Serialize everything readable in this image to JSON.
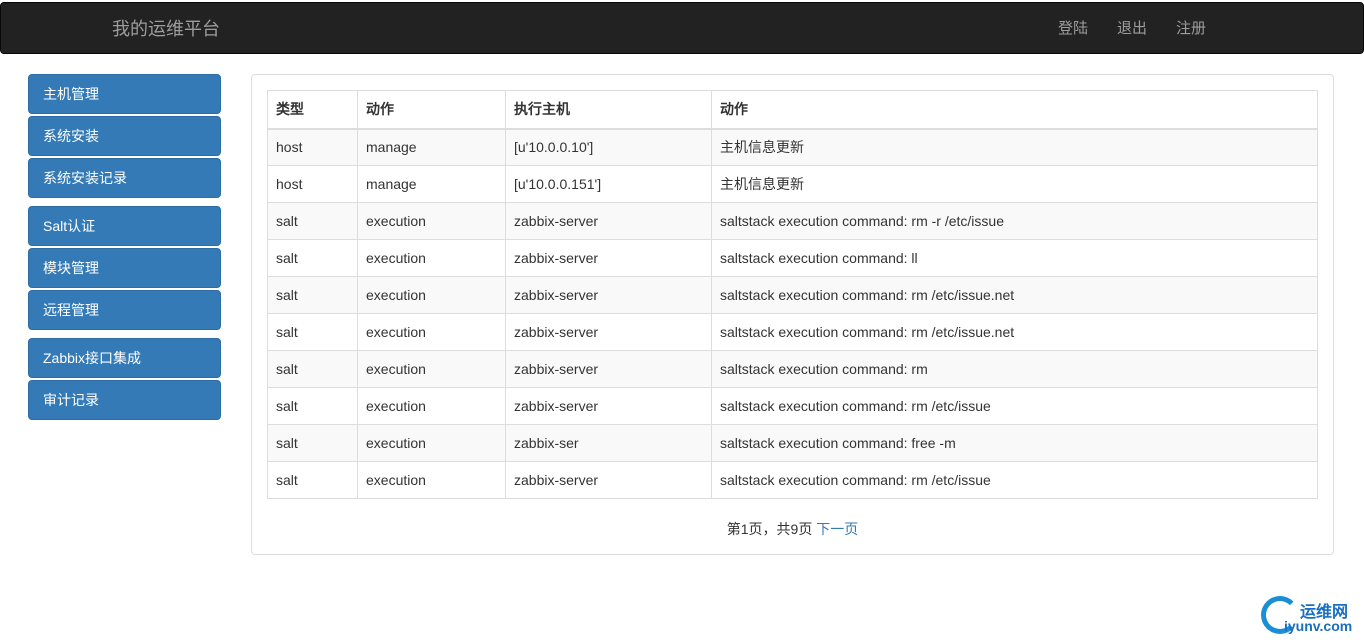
{
  "navbar": {
    "brand": "我的运维平台",
    "links": [
      "登陆",
      "退出",
      "注册"
    ]
  },
  "sidebar": {
    "items": [
      "主机管理",
      "系统安装",
      "系统安装记录",
      "Salt认证",
      "模块管理",
      "远程管理",
      "Zabbix接口集成",
      "审计记录"
    ]
  },
  "table": {
    "headers": [
      "类型",
      "动作",
      "执行主机",
      "动作"
    ],
    "rows": [
      [
        "host",
        "manage",
        "[u'10.0.0.10']",
        "主机信息更新"
      ],
      [
        "host",
        "manage",
        "[u'10.0.0.151']",
        "主机信息更新"
      ],
      [
        "salt",
        "execution",
        "zabbix-server",
        "saltstack execution command: rm -r /etc/issue"
      ],
      [
        "salt",
        "execution",
        "zabbix-server",
        "saltstack execution command: ll"
      ],
      [
        "salt",
        "execution",
        "zabbix-server",
        "saltstack execution command: rm /etc/issue.net"
      ],
      [
        "salt",
        "execution",
        "zabbix-server",
        "saltstack execution command: rm /etc/issue.net"
      ],
      [
        "salt",
        "execution",
        "zabbix-server",
        "saltstack execution command: rm"
      ],
      [
        "salt",
        "execution",
        "zabbix-server",
        "saltstack execution command: rm /etc/issue"
      ],
      [
        "salt",
        "execution",
        "zabbix-ser",
        "saltstack execution command: free -m"
      ],
      [
        "salt",
        "execution",
        "zabbix-server",
        "saltstack execution command: rm /etc/issue"
      ]
    ]
  },
  "pager": {
    "status": "第1页，共9页",
    "next": "下一页"
  },
  "watermark": {
    "name": "运维网",
    "domain": "iyunv.com",
    "color": "#1a6fc0"
  }
}
